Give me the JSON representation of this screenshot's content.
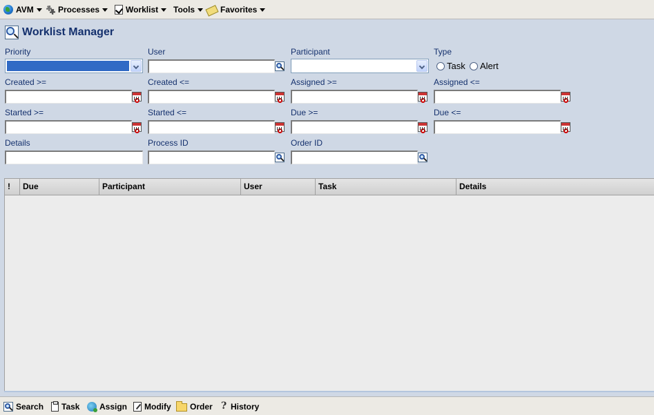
{
  "menubar": {
    "items": [
      {
        "label": "AVM",
        "icon": "globe-icon"
      },
      {
        "label": "Processes",
        "icon": "gears-icon"
      },
      {
        "label": "Worklist",
        "icon": "checklist-icon"
      },
      {
        "label": "Tools",
        "icon": ""
      },
      {
        "label": "Favorites",
        "icon": "favorites-icon"
      }
    ]
  },
  "page": {
    "title": "Worklist Manager"
  },
  "filters": {
    "priority": {
      "label": "Priority",
      "value": ""
    },
    "user": {
      "label": "User",
      "value": ""
    },
    "participant": {
      "label": "Participant",
      "value": ""
    },
    "type": {
      "label": "Type",
      "options": [
        "Task",
        "Alert"
      ],
      "selected": null
    },
    "created_from": {
      "label": "Created >=",
      "value": ""
    },
    "created_to": {
      "label": "Created <=",
      "value": ""
    },
    "assigned_from": {
      "label": "Assigned >=",
      "value": ""
    },
    "assigned_to": {
      "label": "Assigned <=",
      "value": ""
    },
    "started_from": {
      "label": "Started >=",
      "value": ""
    },
    "started_to": {
      "label": "Started <=",
      "value": ""
    },
    "due_from": {
      "label": "Due >=",
      "value": ""
    },
    "due_to": {
      "label": "Due <=",
      "value": ""
    },
    "details": {
      "label": "Details",
      "value": ""
    },
    "process_id": {
      "label": "Process ID",
      "value": ""
    },
    "order_id": {
      "label": "Order ID",
      "value": ""
    }
  },
  "grid": {
    "columns": [
      "!",
      "Due",
      "Participant",
      "User",
      "Task",
      "Details"
    ],
    "rows": []
  },
  "toolbar": {
    "search": "Search",
    "task": "Task",
    "assign": "Assign",
    "modify": "Modify",
    "order": "Order",
    "history": "History"
  },
  "colors": {
    "background": "#cfd8e5",
    "label_text": "#14306d",
    "selection": "#316ac5",
    "bars": "#eceae4"
  }
}
